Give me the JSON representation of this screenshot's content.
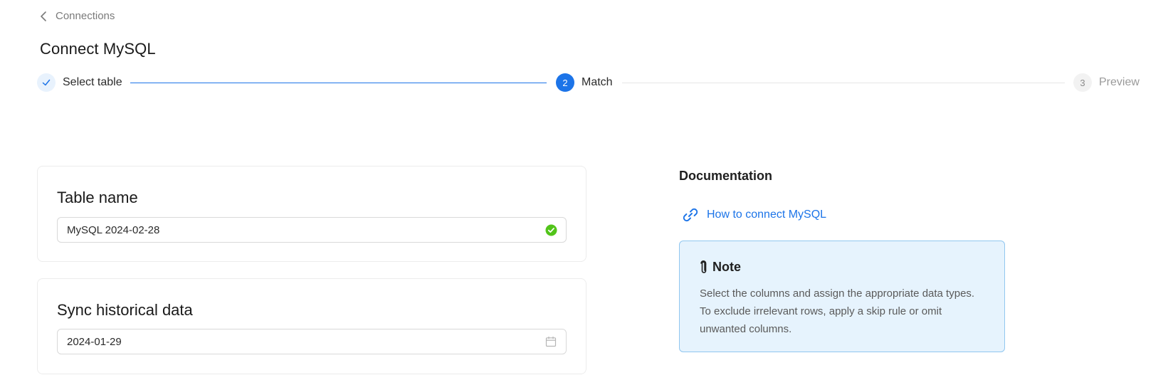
{
  "header": {
    "back_label": "Connections",
    "title": "Connect MySQL"
  },
  "stepper": {
    "steps": [
      {
        "label": "Select table",
        "state": "done"
      },
      {
        "label": "Match",
        "number": "2",
        "state": "active"
      },
      {
        "label": "Preview",
        "number": "3",
        "state": "pending"
      }
    ]
  },
  "table_name_card": {
    "title": "Table name",
    "value": "MySQL 2024-02-28",
    "status_icon": "check-circle-icon"
  },
  "sync_card": {
    "title": "Sync historical data",
    "value": "2024-01-29",
    "icon": "calendar-icon"
  },
  "documentation": {
    "title": "Documentation",
    "link_label": "How to connect MySQL",
    "link_icon": "link-icon"
  },
  "note": {
    "icon": "paperclip-icon",
    "title": "Note",
    "text": "Select the columns and assign the appropriate data types. To exclude irrelevant rows, apply a skip rule or omit unwanted columns."
  },
  "colors": {
    "accent": "#1c74e8",
    "success": "#52c41a",
    "note_bg": "#e6f3fd",
    "note_border": "#91c7f0"
  }
}
